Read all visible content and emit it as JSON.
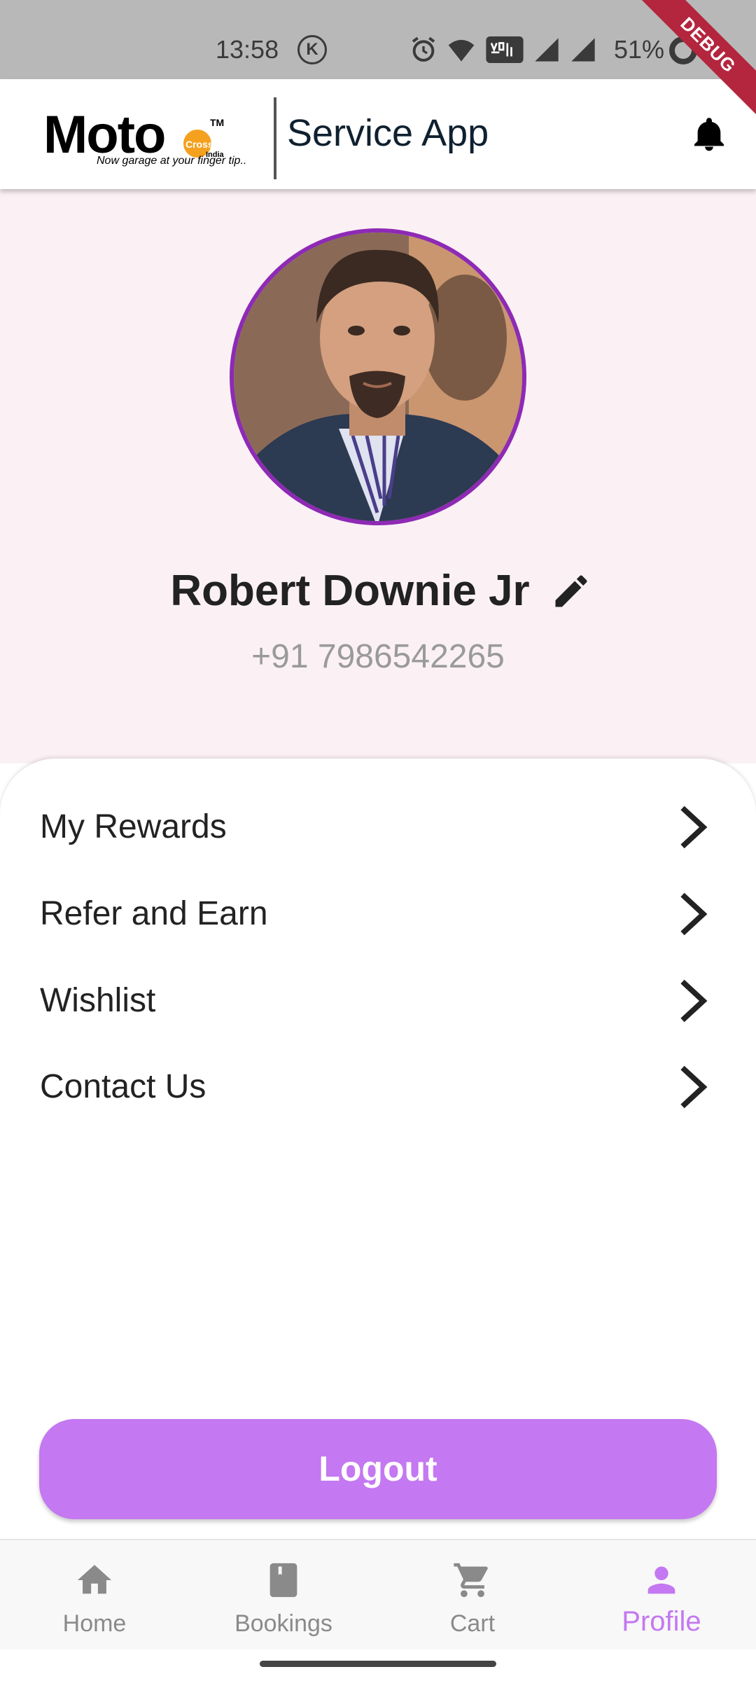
{
  "status_bar": {
    "time": "13:58",
    "k_badge": "K",
    "battery": "51%",
    "debug_banner": "DEBUG"
  },
  "app_bar": {
    "logo": {
      "brand": "Moto",
      "cross": "Cross",
      "india": "India",
      "tm": "TM",
      "tagline": "Now garage at your finger tip.."
    },
    "title": "Service App",
    "notification_icon": "bell-icon"
  },
  "profile": {
    "name": "Robert Downie Jr",
    "phone": "+91 7986542265",
    "edit_icon": "pencil-icon"
  },
  "menu": {
    "items": [
      {
        "label": "My Rewards"
      },
      {
        "label": "Refer and Earn"
      },
      {
        "label": "Wishlist"
      },
      {
        "label": "Contact Us"
      }
    ]
  },
  "logout_label": "Logout",
  "bottom_nav": {
    "active": "Profile",
    "items": [
      {
        "label": "Home",
        "icon": "home-icon"
      },
      {
        "label": "Bookings",
        "icon": "book-icon"
      },
      {
        "label": "Cart",
        "icon": "cart-icon"
      },
      {
        "label": "Profile",
        "icon": "person-icon"
      }
    ]
  },
  "colors": {
    "accent": "#c478f1",
    "avatar_ring": "#8e2ab5",
    "header_bg": "#fbf1f5",
    "debug": "#b3263e"
  }
}
